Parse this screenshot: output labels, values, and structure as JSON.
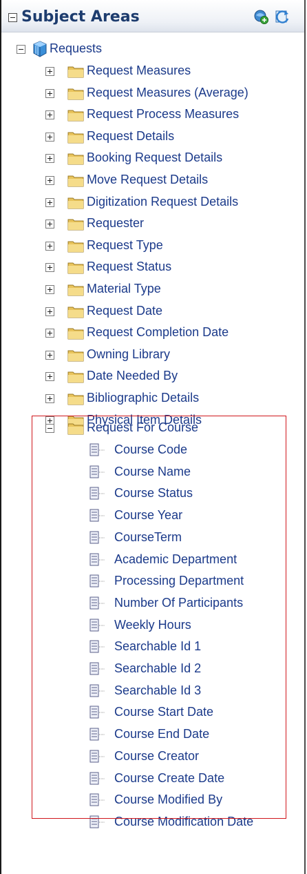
{
  "header": {
    "title": "Subject Areas",
    "icons": [
      "add-subject-area-icon",
      "refresh-icon"
    ]
  },
  "root": {
    "label": "Requests",
    "icon": "subject-area-cube-icon"
  },
  "folders": [
    {
      "label": "Request Measures"
    },
    {
      "label": "Request Measures (Average)"
    },
    {
      "label": "Request Process Measures"
    },
    {
      "label": "Request Details"
    },
    {
      "label": "Booking Request Details"
    },
    {
      "label": "Move Request Details"
    },
    {
      "label": "Digitization Request Details"
    },
    {
      "label": "Requester"
    },
    {
      "label": "Request Type"
    },
    {
      "label": "Request Status"
    },
    {
      "label": "Material Type"
    },
    {
      "label": "Request Date"
    },
    {
      "label": "Request Completion Date"
    },
    {
      "label": "Owning Library"
    },
    {
      "label": "Date Needed By"
    },
    {
      "label": "Bibliographic Details"
    },
    {
      "label": "Physical Item Details"
    }
  ],
  "expanded_folder": {
    "label": "Request For Course",
    "columns": [
      "Course Code",
      "Course Name",
      "Course Status",
      "Course Year",
      "CourseTerm",
      "Academic Department",
      "Processing Department",
      "Number Of Participants",
      "Weekly Hours",
      "Searchable Id 1",
      "Searchable Id 2",
      "Searchable Id 3",
      "Course Start Date",
      "Course End Date",
      "Course Creator",
      "Course Create Date",
      "Course Modified By",
      "Course Modification Date"
    ]
  }
}
